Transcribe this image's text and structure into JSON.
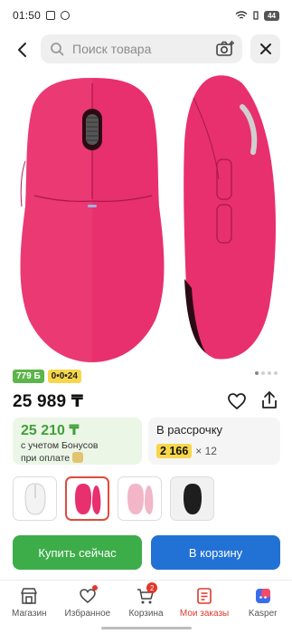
{
  "status_bar": {
    "time": "01:50",
    "battery": "44"
  },
  "search": {
    "placeholder": "Поиск товара"
  },
  "gallery": {
    "image_count": 4,
    "active_index": 0
  },
  "badges": {
    "bonus": "779 Б",
    "installment": "0•0•24"
  },
  "product": {
    "price": "25 989 ₸"
  },
  "bonus_offer": {
    "price": "25 210 ₸",
    "line1": "с учетом Бонусов",
    "line2": "при оплате"
  },
  "installment_offer": {
    "title": "В рассрочку",
    "amount": "2 166",
    "multiplier": "× 12"
  },
  "variants": [
    {
      "name": "white",
      "color": "#f3f3f3"
    },
    {
      "name": "pink",
      "color": "#e8306e"
    },
    {
      "name": "light-pink",
      "color": "#f2b6c8"
    },
    {
      "name": "black",
      "color": "#1e1e1e"
    }
  ],
  "actions": {
    "buy_now": "Купить сейчас",
    "add_to_cart": "В корзину"
  },
  "nav": {
    "home": "Магазин",
    "favorites": "Избранное",
    "cart": "Корзина",
    "cart_count": "2",
    "orders": "Мои заказы",
    "kasper": "Kasper"
  },
  "colors": {
    "accent_red": "#e0382b",
    "green": "#3dad4a",
    "blue": "#2272d6",
    "product_pink": "#e8306e"
  }
}
